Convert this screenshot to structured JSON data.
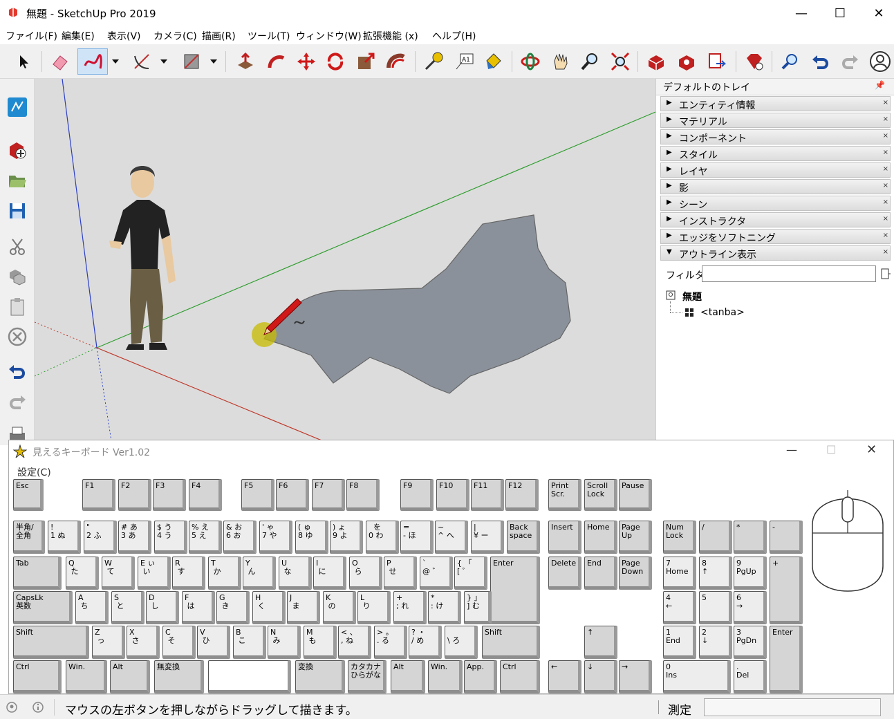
{
  "app": {
    "title": "無題 - SketchUp Pro 2019"
  },
  "window_controls": {
    "minimize": "—",
    "maximize": "☐",
    "close": "✕"
  },
  "menu": [
    "ファイル(F)",
    "編集(E)",
    "表示(V)",
    "カメラ(C)",
    "描画(R)",
    "ツール(T)",
    "ウィンドウ(W)",
    "拡張機能 (x)",
    "ヘルプ(H)"
  ],
  "toolbar_icons": [
    "select-icon",
    "eraser-icon",
    "freehand-icon",
    "dropdown-icon",
    "arc-icon",
    "dropdown-icon",
    "rectangle-icon",
    "dropdown-icon",
    "push-pull-icon",
    "follow-me-icon",
    "move-icon",
    "rotate-icon",
    "scale-icon",
    "offset-icon",
    "tape-measure-icon",
    "text-icon",
    "paint-bucket-icon",
    "orbit-icon",
    "pan-icon",
    "zoom-icon",
    "zoom-extents-icon",
    "warehouse-icon",
    "extension-warehouse-icon",
    "layout-icon",
    "extension-manager-icon",
    "undo-icon",
    "redo-icon",
    "account-icon"
  ],
  "left_toolbar_icons": [
    "sketchup-icon",
    "new-icon",
    "open-icon",
    "save-icon",
    "cut-icon",
    "copy-icon",
    "paste-icon",
    "erase-icon",
    "undo-icon",
    "redo-icon",
    "print-icon"
  ],
  "colors": {
    "axis_red": "#c0392b",
    "axis_green": "#2e9e2e",
    "axis_blue": "#2a3ec4",
    "shape_fill": "#8a919a",
    "viewport_bg": "#dcdcdc"
  },
  "tray": {
    "title": "デフォルトのトレイ",
    "pin": "📌",
    "panels": [
      {
        "arrow": "▶",
        "label": "エンティティ情報"
      },
      {
        "arrow": "▶",
        "label": "マテリアル"
      },
      {
        "arrow": "▶",
        "label": "コンポーネント"
      },
      {
        "arrow": "▶",
        "label": "スタイル"
      },
      {
        "arrow": "▶",
        "label": "レイヤ"
      },
      {
        "arrow": "▶",
        "label": "影"
      },
      {
        "arrow": "▶",
        "label": "シーン"
      },
      {
        "arrow": "▶",
        "label": "インストラクタ"
      },
      {
        "arrow": "▶",
        "label": "エッジをソフトニング"
      },
      {
        "arrow": "▼",
        "label": "アウトライン表示"
      }
    ],
    "panel_close": "×",
    "filter_label": "フィルタ:",
    "filter_value": "",
    "outliner_root": "無題",
    "outliner_child": "<tanba>"
  },
  "keyboard_window": {
    "title": "見えるキーボード Ver1.02",
    "menu": "設定(C)",
    "keys": [
      {
        "t": "Esc",
        "name": "key-esc"
      },
      {
        "t": "F1",
        "name": "key-f1"
      },
      {
        "t": "F2",
        "name": "key-f2"
      },
      {
        "t": "F3",
        "name": "key-f3"
      },
      {
        "t": "F4",
        "name": "key-f4"
      },
      {
        "t": "F5",
        "name": "key-f5"
      },
      {
        "t": "F6",
        "name": "key-f6"
      },
      {
        "t": "F7",
        "name": "key-f7"
      },
      {
        "t": "F8",
        "name": "key-f8"
      },
      {
        "t": "F9",
        "name": "key-f9"
      },
      {
        "t": "F10",
        "name": "key-f10"
      },
      {
        "t": "F11",
        "name": "key-f11"
      },
      {
        "t": "F12",
        "name": "key-f12"
      },
      {
        "t": "Print\nScr.",
        "name": "key-printscr"
      },
      {
        "t": "Scroll\nLock",
        "name": "key-scrolllock"
      },
      {
        "t": "Pause",
        "name": "key-pause"
      },
      {
        "t": "半角/\n全角",
        "name": "key-hankaku"
      },
      {
        "t": "!\n1 ぬ",
        "name": "key-1"
      },
      {
        "t": "\"\n2 ふ",
        "name": "key-2"
      },
      {
        "t": "# あ\n3 あ",
        "name": "key-3"
      },
      {
        "t": "$ う\n4 う",
        "name": "key-4"
      },
      {
        "t": "% え\n5 え",
        "name": "key-5"
      },
      {
        "t": "& お\n6 お",
        "name": "key-6"
      },
      {
        "t": "' ゃ\n7 や",
        "name": "key-7"
      },
      {
        "t": "( ゅ\n8 ゆ",
        "name": "key-8"
      },
      {
        "t": ") ょ\n9 よ",
        "name": "key-9"
      },
      {
        "t": "  を\n0 わ",
        "name": "key-0"
      },
      {
        "t": "=\n- ほ",
        "name": "key-minus"
      },
      {
        "t": "~\n^ へ",
        "name": "key-caret"
      },
      {
        "t": "|\n¥ ー",
        "name": "key-yen"
      },
      {
        "t": "Back\nspace",
        "name": "key-backspace"
      },
      {
        "t": "Insert",
        "name": "key-insert"
      },
      {
        "t": "Home",
        "name": "key-home"
      },
      {
        "t": "Page\nUp",
        "name": "key-pageup"
      },
      {
        "t": "Num\nLock",
        "name": "key-numlock"
      },
      {
        "t": "/",
        "name": "key-num-slash"
      },
      {
        "t": "*",
        "name": "key-num-star"
      },
      {
        "t": "-",
        "name": "key-num-minus"
      },
      {
        "t": "Tab",
        "name": "key-tab"
      },
      {
        "t": "Q\n た",
        "name": "key-q"
      },
      {
        "t": "W\n て",
        "name": "key-w"
      },
      {
        "t": "E ぃ\n い",
        "name": "key-e"
      },
      {
        "t": "R\n す",
        "name": "key-r"
      },
      {
        "t": "T\n か",
        "name": "key-t"
      },
      {
        "t": "Y\n ん",
        "name": "key-y"
      },
      {
        "t": "U\n な",
        "name": "key-u"
      },
      {
        "t": "I\n に",
        "name": "key-i"
      },
      {
        "t": "O\n ら",
        "name": "key-o"
      },
      {
        "t": "P\n せ",
        "name": "key-p"
      },
      {
        "t": "`\n@ ゛",
        "name": "key-at"
      },
      {
        "t": "{ 「\n[ ゜",
        "name": "key-bracket"
      },
      {
        "t": "Enter",
        "name": "key-enter"
      },
      {
        "t": "Delete",
        "name": "key-delete"
      },
      {
        "t": "End",
        "name": "key-end"
      },
      {
        "t": "Page\nDown",
        "name": "key-pagedown"
      },
      {
        "t": "7\nHome",
        "name": "key-num7"
      },
      {
        "t": "8\n↑",
        "name": "key-num8"
      },
      {
        "t": "9\nPgUp",
        "name": "key-num9"
      },
      {
        "t": "+",
        "name": "key-num-plus"
      },
      {
        "t": "CapsLk\n英数",
        "name": "key-capslock"
      },
      {
        "t": "A\n ち",
        "name": "key-a"
      },
      {
        "t": "S\n と",
        "name": "key-s"
      },
      {
        "t": "D\n し",
        "name": "key-d"
      },
      {
        "t": "F\n は",
        "name": "key-f"
      },
      {
        "t": "G\n き",
        "name": "key-g"
      },
      {
        "t": "H\n く",
        "name": "key-h"
      },
      {
        "t": "J\n ま",
        "name": "key-j"
      },
      {
        "t": "K\n の",
        "name": "key-k"
      },
      {
        "t": "L\n り",
        "name": "key-l"
      },
      {
        "t": "+\n; れ",
        "name": "key-semicolon"
      },
      {
        "t": "*\n: け",
        "name": "key-colon"
      },
      {
        "t": "} 」\n] む",
        "name": "key-closebracket"
      },
      {
        "t": "4\n←",
        "name": "key-num4"
      },
      {
        "t": "5",
        "name": "key-num5"
      },
      {
        "t": "6\n→",
        "name": "key-num6"
      },
      {
        "t": "Shift",
        "name": "key-shift-left"
      },
      {
        "t": "Z\n っ",
        "name": "key-z"
      },
      {
        "t": "X\n さ",
        "name": "key-x"
      },
      {
        "t": "C\n そ",
        "name": "key-c"
      },
      {
        "t": "V\n ひ",
        "name": "key-v"
      },
      {
        "t": "B\n こ",
        "name": "key-b"
      },
      {
        "t": "N\n み",
        "name": "key-n"
      },
      {
        "t": "M\n も",
        "name": "key-m"
      },
      {
        "t": "< 、\n, ね",
        "name": "key-comma"
      },
      {
        "t": "> 。\n. る",
        "name": "key-period"
      },
      {
        "t": "? ・\n/ め",
        "name": "key-slash"
      },
      {
        "t": "\n\\ ろ",
        "name": "key-backslash"
      },
      {
        "t": "Shift",
        "name": "key-shift-right"
      },
      {
        "t": "↑",
        "name": "key-up"
      },
      {
        "t": "1\nEnd",
        "name": "key-num1"
      },
      {
        "t": "2\n↓",
        "name": "key-num2"
      },
      {
        "t": "3\nPgDn",
        "name": "key-num3"
      },
      {
        "t": "Enter",
        "name": "key-num-enter"
      },
      {
        "t": "Ctrl",
        "name": "key-ctrl-left"
      },
      {
        "t": "Win.",
        "name": "key-win-left"
      },
      {
        "t": "Alt",
        "name": "key-alt-left"
      },
      {
        "t": "無変換",
        "name": "key-muhenkan"
      },
      {
        "t": "",
        "name": "key-space"
      },
      {
        "t": "変換",
        "name": "key-henkan"
      },
      {
        "t": "カタカナ\nひらがな",
        "name": "key-katakana"
      },
      {
        "t": "Alt",
        "name": "key-alt-right"
      },
      {
        "t": "Win.",
        "name": "key-win-right"
      },
      {
        "t": "App.",
        "name": "key-app"
      },
      {
        "t": "Ctrl",
        "name": "key-ctrl-right"
      },
      {
        "t": "←",
        "name": "key-left"
      },
      {
        "t": "↓",
        "name": "key-down"
      },
      {
        "t": "→",
        "name": "key-right"
      },
      {
        "t": "0\nIns",
        "name": "key-num0"
      },
      {
        "t": ".\nDel",
        "name": "key-num-del"
      }
    ]
  },
  "status": {
    "message": "マウスの左ボタンを押しながらドラッグして描きます。",
    "measure_label": "測定",
    "measure_value": ""
  }
}
